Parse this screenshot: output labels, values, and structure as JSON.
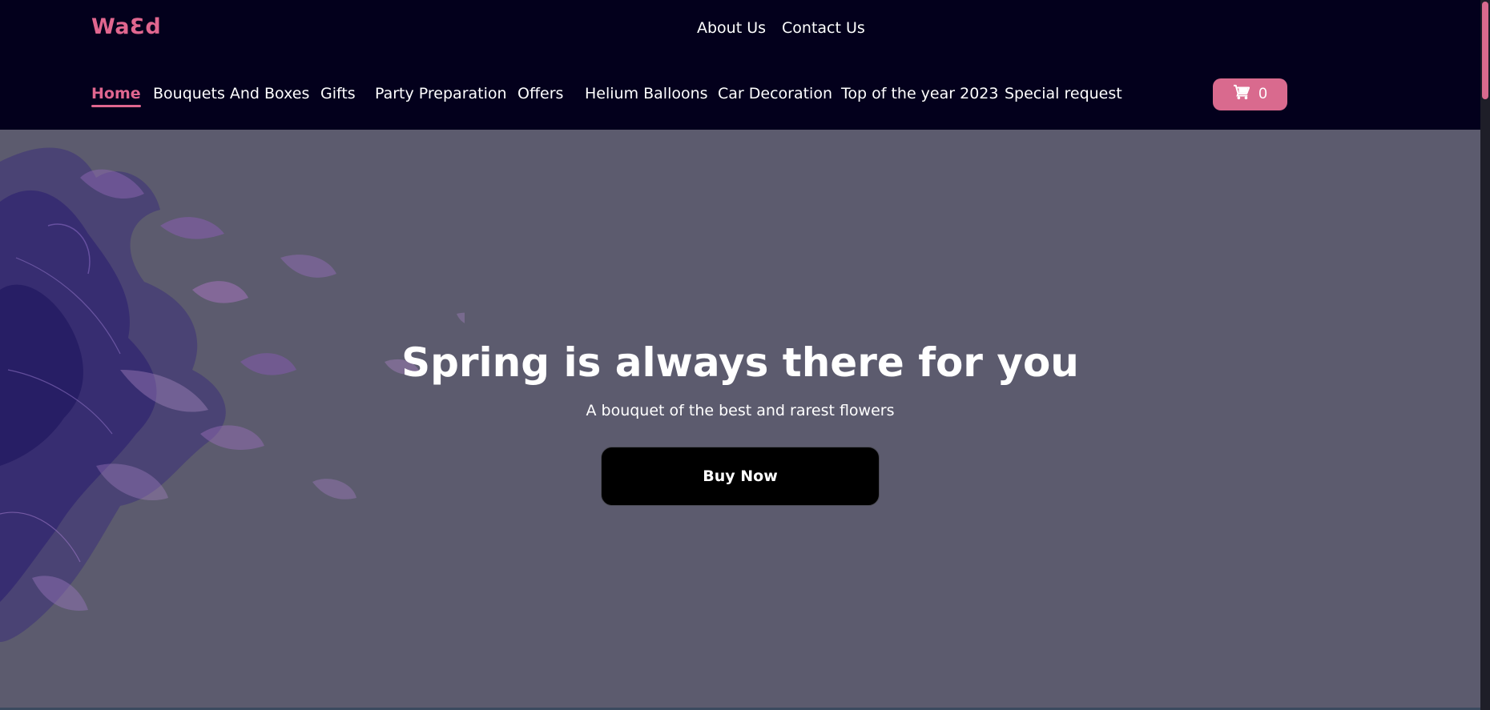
{
  "brand": {
    "logo": "WaƐd",
    "accent_color": "#e0668f"
  },
  "header": {
    "top_links": [
      "About Us",
      "Contact Us"
    ],
    "nav": [
      {
        "label": "Home",
        "active": true
      },
      {
        "label": "Bouquets And Boxes",
        "active": false
      },
      {
        "label": "Gifts",
        "active": false
      },
      {
        "label": "Party Preparation",
        "active": false
      },
      {
        "label": "Offers",
        "active": false
      },
      {
        "label": "Helium Balloons",
        "active": false
      },
      {
        "label": "Car Decoration",
        "active": false
      },
      {
        "label": "Top of the year 2023",
        "active": false
      },
      {
        "label": "Special request",
        "active": false
      }
    ],
    "cart": {
      "icon": "cart-icon",
      "count": "0"
    }
  },
  "hero": {
    "title": "Spring is always there for you",
    "subtitle": "A bouquet of the best and rarest flowers",
    "button_label": "Buy Now"
  }
}
